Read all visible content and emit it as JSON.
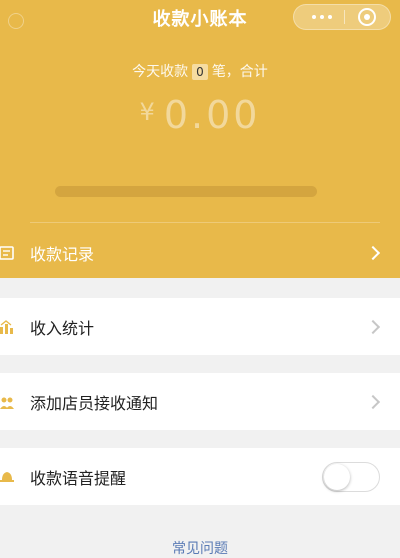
{
  "header": {
    "title": "收款小账本",
    "summary_prefix": "今天收款",
    "count": "0",
    "summary_suffix": "笔，合计",
    "currency": "¥",
    "amount": "0.00"
  },
  "menu": {
    "records": "收款记录",
    "stats": "收入统计",
    "staff_notify": "添加店员接收通知",
    "voice_reminder": "收款语音提醒",
    "voice_reminder_on": false
  },
  "footer": {
    "faq": "常见问题"
  },
  "colors": {
    "accent": "#e8b94a",
    "link": "#5a7bb5"
  },
  "icons": [
    "home-icon",
    "more-icon",
    "close-icon",
    "list-icon",
    "chart-icon",
    "staff-icon",
    "bell-icon",
    "chevron-right-icon"
  ]
}
